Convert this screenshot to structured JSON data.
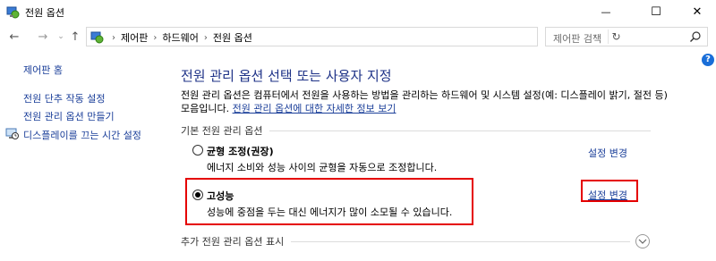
{
  "window": {
    "title": "전원 옵션",
    "minimize_glyph": "—",
    "maximize_glyph": "☐",
    "close_glyph": "✕"
  },
  "address": {
    "breadcrumbs": [
      "제어판",
      "하드웨어",
      "전원 옵션"
    ],
    "search_placeholder": "제어판 검색"
  },
  "sidebar": {
    "home": "제어판 홈",
    "items": [
      {
        "label": "전원 단추 작동 설정"
      },
      {
        "label": "전원 관리 옵션 만들기"
      },
      {
        "label": "디스플레이를 끄는 시간 설정",
        "icon": "display-clock-icon"
      }
    ]
  },
  "main": {
    "title": "전원 관리 옵션 선택 또는 사용자 지정",
    "description": "전원 관리 옵션은 컴퓨터에서 전원을 사용하는 방법을 관리하는 하드웨어 및 시스템 설정(예: 디스플레이 밝기, 절전 등) 모음입니다. ",
    "description_link": "전원 관리 옵션에 대한 자세한 정보 보기",
    "group_label": "기본 전원 관리 옵션",
    "plans": [
      {
        "name": "균형 조정(권장)",
        "description": "에너지 소비와 성능 사이의 균형을 자동으로 조정합니다.",
        "selected": false,
        "change_label": "설정 변경"
      },
      {
        "name": "고성능",
        "description": "성능에 중점을 두는 대신 에너지가 많이 소모될 수 있습니다.",
        "selected": true,
        "change_label": "설정 변경"
      }
    ],
    "more_label": "추가 전원 관리 옵션 표시"
  },
  "colors": {
    "link": "#1a3e99",
    "title": "#1e3287",
    "highlight": "#e50000",
    "help": "#1a6ed8"
  }
}
